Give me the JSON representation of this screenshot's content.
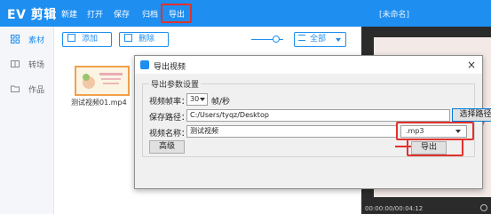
{
  "app": {
    "logo": "EV 剪辑",
    "menu": [
      "新建",
      "打开",
      "保存",
      "归档",
      "导出"
    ],
    "doc_title": "[未命名]"
  },
  "sidebar": {
    "items": [
      {
        "label": "素材",
        "icon": "grid-icon",
        "active": true
      },
      {
        "label": "转场",
        "icon": "transition-icon",
        "active": false
      },
      {
        "label": "作品",
        "icon": "folder-icon",
        "active": false
      }
    ]
  },
  "toolbar": {
    "add_label": "添加",
    "delete_label": "删除",
    "filter_label": "全部"
  },
  "media": {
    "filename": "测试视频01.mp4"
  },
  "preview": {
    "time": "00:00:00/00:04:12"
  },
  "dialog": {
    "title": "导出视频",
    "close": "×",
    "group_title": "导出参数设置",
    "fps_label": "视频帧率：",
    "fps_value": "30",
    "fps_unit": "帧/秒",
    "path_label": "保存路径：",
    "path_value": "C:/Users/tyqz/Desktop",
    "browse_label": "选择路径",
    "name_label": "视频名称：",
    "name_value": "测试视频",
    "ext_value": ".mp3",
    "advanced_label": "高级",
    "export_label": "导出"
  },
  "colors": {
    "accent": "#1e8ef0",
    "highlight": "#e0322d"
  }
}
